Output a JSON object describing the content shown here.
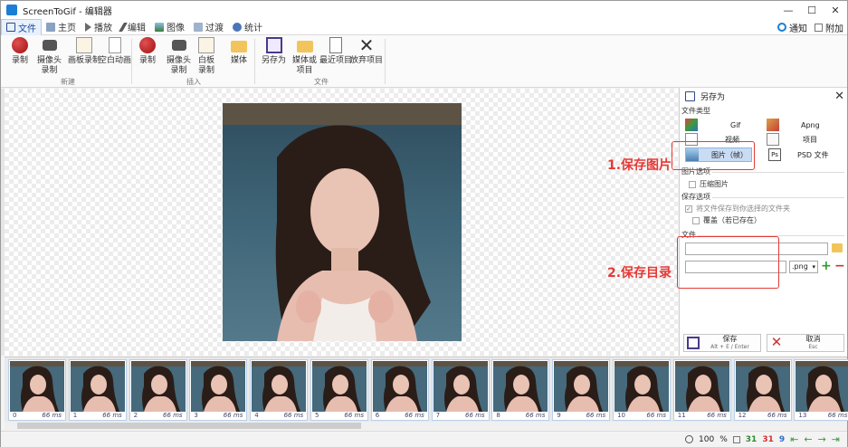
{
  "window": {
    "title": "ScreenToGif - 编辑器",
    "min": "—",
    "max": "☐",
    "close": "✕"
  },
  "tabs": [
    {
      "label": "文件",
      "color": "#c0392b"
    },
    {
      "label": "主页",
      "color": "#7a7a7a"
    },
    {
      "label": "播放",
      "color": "#7a7a7a"
    },
    {
      "label": "编辑",
      "color": "#7a7a7a"
    },
    {
      "label": "图像",
      "color": "#7a7a7a"
    },
    {
      "label": "过渡",
      "color": "#7a7a7a"
    },
    {
      "label": "统计",
      "color": "#7a7a7a"
    }
  ],
  "menu_right": {
    "notify": "通知",
    "attach": "附加"
  },
  "ribbon": {
    "new_group": "新建",
    "insert_group": "插入",
    "file_group": "文件",
    "buttons": {
      "record": "录制",
      "webcam": "摄像头\n录制",
      "board": "画板录制",
      "blank": "空白动画",
      "ins_record": "录制",
      "ins_webcam": "摄像头\n录制",
      "ins_board": "白板\n录制",
      "media": "媒体",
      "save_as": "另存为",
      "media_or_project": "媒体或\n项目",
      "recent": "最近项目",
      "discard": "放弃项目"
    }
  },
  "panel": {
    "title": "另存为",
    "file_type_label": "文件类型",
    "types": {
      "gif": "Gif",
      "apng": "Apng",
      "video": "视频",
      "project": "项目",
      "image": "图片（帧）",
      "psd": "PSD 文件"
    },
    "image_options_label": "图片选项",
    "zip_images": "压缩图片",
    "save_options_label": "保存选项",
    "save_to_folder": "将文件保存到你选择的文件夹",
    "overwrite": "覆盖（若已存在）",
    "file_label": "文件",
    "folder_value": "",
    "filename_value": "",
    "extension": ".png",
    "save_button": "保存",
    "save_shortcut": "Alt + E / Enter",
    "cancel_button": "取消",
    "cancel_shortcut": "Esc"
  },
  "annotations": {
    "step1": "1.保存图片",
    "step2": "2.保存目录"
  },
  "frames": [
    {
      "num": "0",
      "ms": "66 ms"
    },
    {
      "num": "1",
      "ms": "66 ms"
    },
    {
      "num": "2",
      "ms": "66 ms"
    },
    {
      "num": "3",
      "ms": "66 ms"
    },
    {
      "num": "4",
      "ms": "66 ms"
    },
    {
      "num": "5",
      "ms": "66 ms"
    },
    {
      "num": "6",
      "ms": "66 ms"
    },
    {
      "num": "7",
      "ms": "66 ms"
    },
    {
      "num": "8",
      "ms": "66 ms"
    },
    {
      "num": "9",
      "ms": "66 ms"
    },
    {
      "num": "10",
      "ms": "66 ms"
    },
    {
      "num": "11",
      "ms": "66 ms"
    },
    {
      "num": "12",
      "ms": "66 ms"
    },
    {
      "num": "13",
      "ms": "66 ms"
    }
  ],
  "status": {
    "zoom": "100",
    "percent": "%",
    "total_frames": "31",
    "selected_frames": "31",
    "current_frame": "9"
  },
  "colors": {
    "accent": "#1b7fd6",
    "annotation": "#e53935",
    "selected": "#c9dcf3",
    "frame_count_green": "#2e8b2e",
    "frame_count_red": "#d03030"
  }
}
